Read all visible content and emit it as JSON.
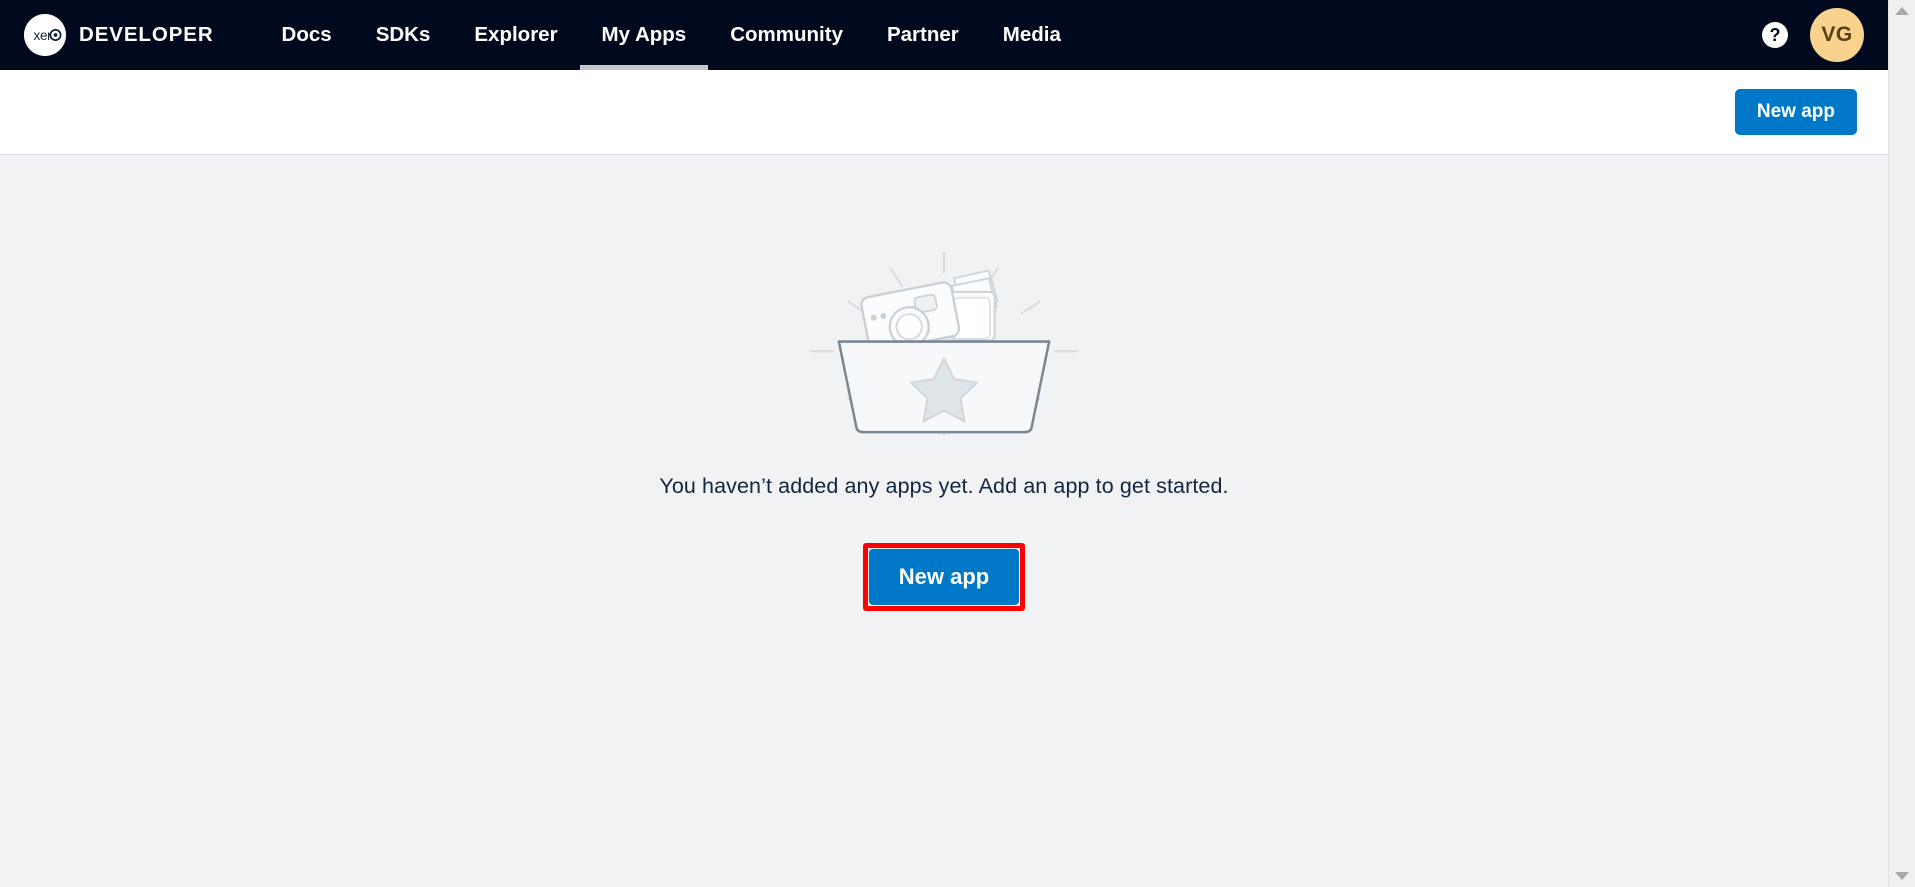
{
  "header": {
    "brand": {
      "logo_icon": "xero-logo-icon",
      "logo_text": "xero",
      "word": "DEVELOPER"
    },
    "nav": [
      {
        "label": "Docs",
        "active": false
      },
      {
        "label": "SDKs",
        "active": false
      },
      {
        "label": "Explorer",
        "active": false
      },
      {
        "label": "My Apps",
        "active": true
      },
      {
        "label": "Community",
        "active": false
      },
      {
        "label": "Partner",
        "active": false
      },
      {
        "label": "Media",
        "active": false
      }
    ],
    "help": {
      "icon": "question-mark-icon",
      "glyph": "?"
    },
    "avatar": {
      "initials": "VG",
      "icon": "user-avatar"
    }
  },
  "toolbar": {
    "new_app_label": "New app"
  },
  "empty_state": {
    "illustration_icon": "empty-basket-illustration",
    "message": "You haven’t added any apps yet. Add an app to get started.",
    "cta_label": "New app",
    "highlighted": true
  },
  "scrollbar": {
    "up_icon": "scroll-up-arrow-icon",
    "down_icon": "scroll-down-arrow-icon"
  },
  "colors": {
    "header_bg": "#00091d",
    "page_bg": "#f1f2f4",
    "toolbar_bg": "#ffffff",
    "primary_blue": "#0078c8",
    "avatar_bg": "#f9d28d",
    "avatar_text": "#5a4114",
    "active_tab_underline": "#c3c7cc",
    "annotation_red": "#fe0000",
    "body_text": "#12263f"
  }
}
